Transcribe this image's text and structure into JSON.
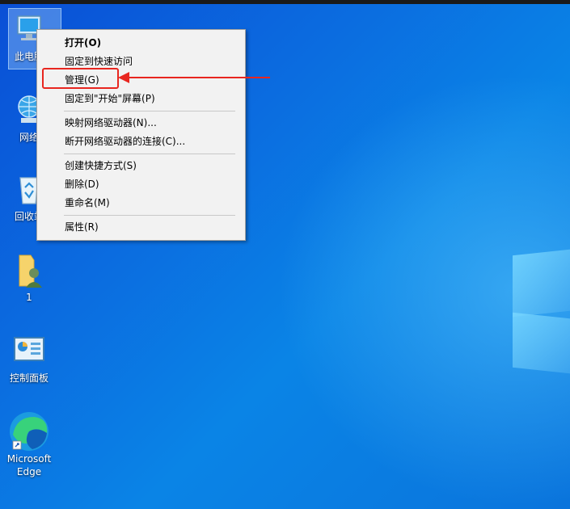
{
  "desktop": {
    "icons": [
      {
        "label": "此电脑",
        "icon": "computer-icon"
      },
      {
        "label": "网络",
        "icon": "network-icon"
      },
      {
        "label": "回收站",
        "icon": "recycle-bin-icon"
      },
      {
        "label": "1",
        "icon": "user-folder-icon"
      },
      {
        "label": "控制面板",
        "icon": "control-panel-icon"
      },
      {
        "label": "Microsoft Edge",
        "icon": "edge-icon"
      }
    ]
  },
  "context_menu": {
    "items": [
      {
        "label": "打开(O)"
      },
      {
        "label": "固定到快速访问"
      },
      {
        "label": "管理(G)"
      },
      {
        "label": "固定到\"开始\"屏幕(P)"
      },
      {
        "label": "映射网络驱动器(N)..."
      },
      {
        "label": "断开网络驱动器的连接(C)..."
      },
      {
        "label": "创建快捷方式(S)"
      },
      {
        "label": "删除(D)"
      },
      {
        "label": "重命名(M)"
      },
      {
        "label": "属性(R)"
      }
    ]
  },
  "annotation": {
    "color": "#e8261f"
  }
}
